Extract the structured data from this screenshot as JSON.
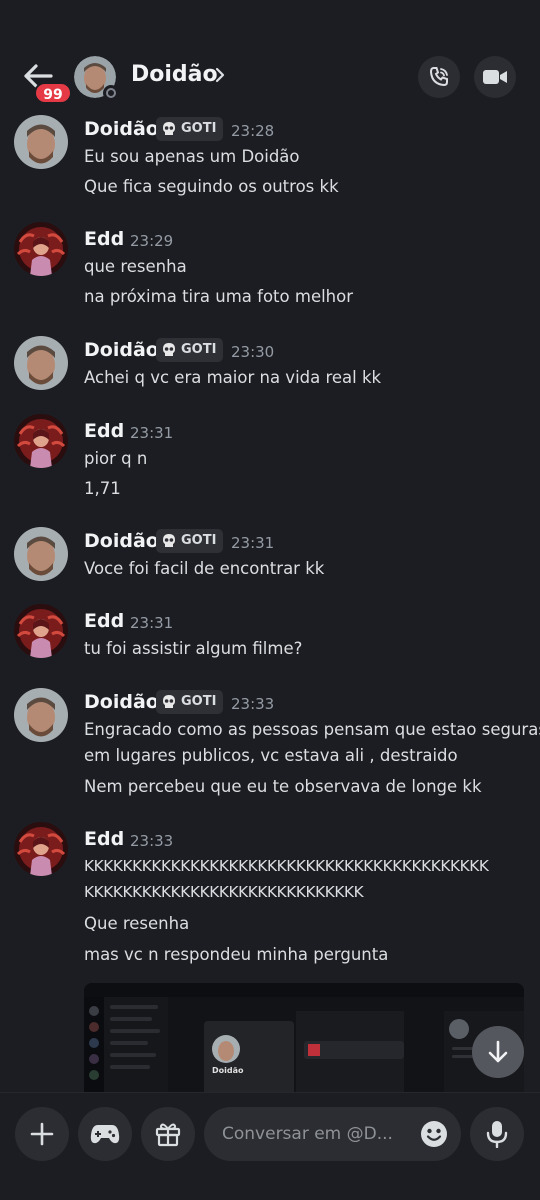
{
  "header": {
    "back_badge": "99",
    "title": "Doidão"
  },
  "guild_tag": "GOTI",
  "messages": [
    {
      "author": "Doidão",
      "tag": "GOTI",
      "time": "23:28",
      "lines": [
        "Eu sou apenas um Doidão",
        "Que fica seguindo os outros kk"
      ]
    },
    {
      "author": "Edd",
      "time": "23:29",
      "lines": [
        "que resenha",
        "na próxima tira uma foto melhor"
      ]
    },
    {
      "author": "Doidão",
      "tag": "GOTI",
      "time": "23:30",
      "lines": [
        "Achei q vc era maior na vida real kk"
      ]
    },
    {
      "author": "Edd",
      "time": "23:31",
      "lines": [
        "pior q n",
        "1,71"
      ]
    },
    {
      "author": "Doidão",
      "tag": "GOTI",
      "time": "23:31",
      "lines": [
        "Voce foi facil de encontrar kk"
      ]
    },
    {
      "author": "Edd",
      "time": "23:31",
      "lines": [
        "tu foi assistir algum filme?"
      ]
    },
    {
      "author": "Doidão",
      "tag": "GOTI",
      "time": "23:33",
      "lines": [
        "Engracado como as pessoas pensam que estao seguras",
        "em lugares publicos, vc estava ali , destraido",
        "Nem percebeu que eu te observava de longe kk"
      ]
    },
    {
      "author": "Edd",
      "time": "23:33",
      "lines": [
        "KKKKKKKKKKKKKKKKKKKKKKKKKKKKKKKKKKKKKKKKKK",
        "KKKKKKKKKKKKKKKKKKKKKKKKKKKKK",
        "Que resenha",
        "mas vc n respondeu minha pergunta"
      ]
    }
  ],
  "embed": {
    "profile_name": "Doidão"
  },
  "composer": {
    "placeholder": "Conversar em @D..."
  },
  "icons": {
    "back": "arrow-left-icon",
    "chevron": "chevron-right-icon",
    "call": "phone-call-icon",
    "video": "video-camera-icon",
    "add": "plus-icon",
    "games": "gamepad-icon",
    "gift": "gift-icon",
    "emoji": "smiley-icon",
    "mic": "microphone-icon",
    "scroll": "arrow-down-icon",
    "tag": "skull-icon"
  },
  "colors": {
    "background": "#1c1d22",
    "badge": "#e53a45",
    "text": "#dbdee1",
    "muted": "#949ba4"
  }
}
